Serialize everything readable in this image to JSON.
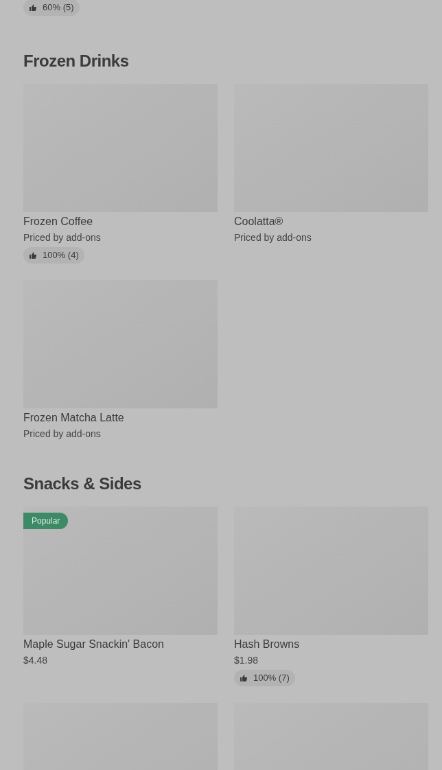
{
  "top_fragment": {
    "rating": "60% (5)"
  },
  "sections": [
    {
      "title": "Frozen Drinks",
      "items": [
        {
          "kind": "product",
          "name": "Frozen Coffee",
          "price": "Priced by add-ons",
          "rating": "100% (4)"
        },
        {
          "kind": "product",
          "name": "Coolatta®",
          "price": "Priced by add-ons"
        },
        {
          "kind": "product",
          "name": "Frozen Matcha Latte",
          "price": "Priced by add-ons"
        }
      ]
    },
    {
      "title": "Snacks & Sides",
      "items": [
        {
          "kind": "product",
          "name": "Maple Sugar Snackin' Bacon",
          "price": "$4.48",
          "badge": "Popular"
        },
        {
          "kind": "product",
          "name": "Hash Browns",
          "price": "$1.98",
          "rating": "100% (7)"
        },
        {
          "kind": "picture"
        },
        {
          "kind": "picture"
        }
      ]
    }
  ]
}
